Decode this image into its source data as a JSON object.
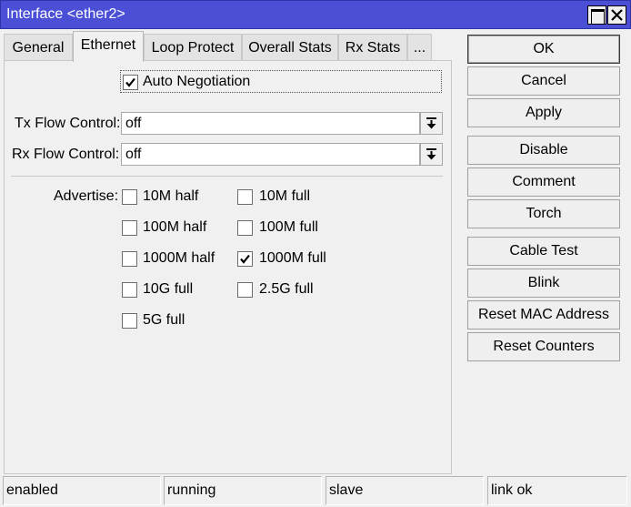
{
  "window": {
    "title": "Interface <ether2>"
  },
  "tabs": [
    "General",
    "Ethernet",
    "Loop Protect",
    "Overall Stats",
    "Rx Stats",
    "..."
  ],
  "active_tab": "Ethernet",
  "ethernet": {
    "auto_negotiation": {
      "label": "Auto Negotiation",
      "checked": true
    },
    "tx_flow_control": {
      "label": "Tx Flow Control:",
      "value": "off"
    },
    "rx_flow_control": {
      "label": "Rx Flow Control:",
      "value": "off"
    },
    "advertise": {
      "label": "Advertise:",
      "options": [
        {
          "label": "10M half",
          "checked": false
        },
        {
          "label": "10M full",
          "checked": false
        },
        {
          "label": "100M half",
          "checked": false
        },
        {
          "label": "100M full",
          "checked": false
        },
        {
          "label": "1000M half",
          "checked": false
        },
        {
          "label": "1000M full",
          "checked": true
        },
        {
          "label": "10G full",
          "checked": false
        },
        {
          "label": "2.5G full",
          "checked": false
        },
        {
          "label": "5G full",
          "checked": false
        }
      ]
    }
  },
  "buttons": [
    "OK",
    "Cancel",
    "Apply",
    "Disable",
    "Comment",
    "Torch",
    "Cable Test",
    "Blink",
    "Reset MAC Address",
    "Reset Counters"
  ],
  "status_bar": [
    "enabled",
    "running",
    "slave",
    "link ok"
  ],
  "colors": {
    "titlebar": "#4a4fd6",
    "background": "#f0f0f0"
  }
}
